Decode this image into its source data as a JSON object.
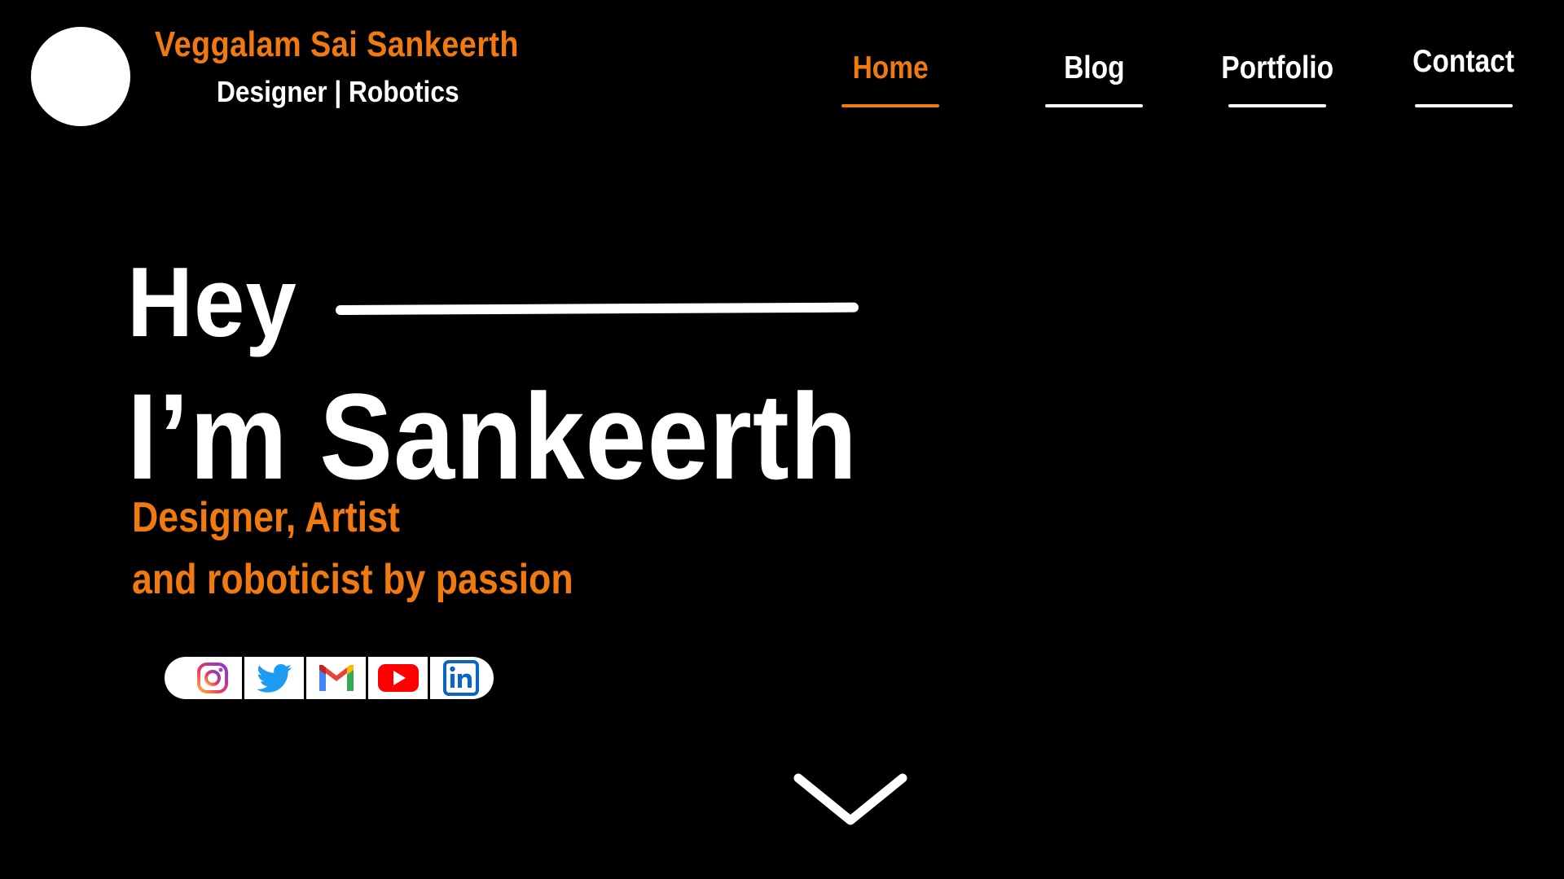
{
  "brand": {
    "name": "Veggalam Sai Sankeerth",
    "tagline": "Designer | Robotics"
  },
  "nav": {
    "items": [
      {
        "label": "Home",
        "active": true
      },
      {
        "label": "Blog",
        "active": false
      },
      {
        "label": "Portfolio",
        "active": false
      },
      {
        "label": "Contact",
        "active": false
      }
    ]
  },
  "hero": {
    "greeting": "Hey",
    "name_line": "I’m Sankeerth",
    "subtitle_line1": "Designer, Artist",
    "subtitle_line2": "and roboticist by passion"
  },
  "social": {
    "icons": [
      "instagram-icon",
      "twitter-icon",
      "gmail-icon",
      "youtube-icon",
      "linkedin-icon"
    ],
    "linkedin_text": "in"
  },
  "scroll": {
    "icon": "chevron-down-icon"
  },
  "colors": {
    "background": "#000000",
    "accent": "#f07a10",
    "text": "#ffffff"
  }
}
